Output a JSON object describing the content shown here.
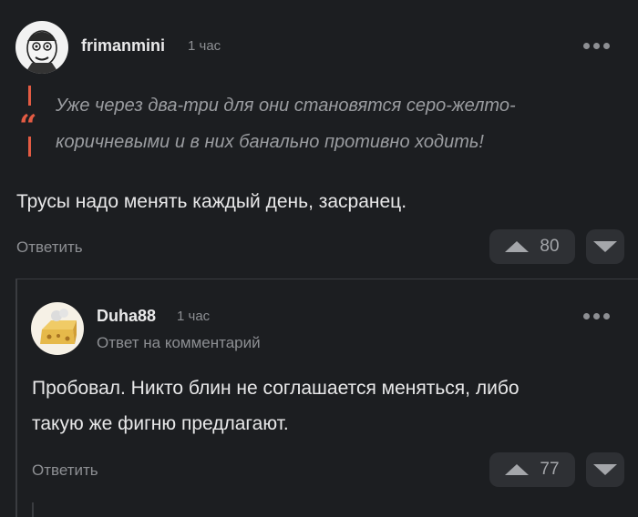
{
  "comment": {
    "username": "frimanmini",
    "time": "1 час",
    "quote_mark": "“",
    "quote_line1": "Уже через два-три для они становятся серо-желто-",
    "quote_line2": "коричневыми и в них банально противно ходить!",
    "text": "Трусы надо менять каждый день, засранец.",
    "reply_label": "Ответить",
    "rating": "80"
  },
  "reply": {
    "username": "Duha88",
    "time": "1 час",
    "sub": "Ответ на комментарий",
    "text_line1": "Пробовал. Никто блин не соглашается меняться, либо",
    "text_line2": "такую же фигню предлагают.",
    "reply_label": "Ответить",
    "rating": "77"
  },
  "colors": {
    "background": "#1c1e21",
    "quote_accent": "#e35b43",
    "muted": "#8d8f93",
    "button_bg": "#2e3034"
  },
  "icons": [
    "more-icon",
    "quote-icon",
    "upvote-icon",
    "downvote-icon"
  ]
}
